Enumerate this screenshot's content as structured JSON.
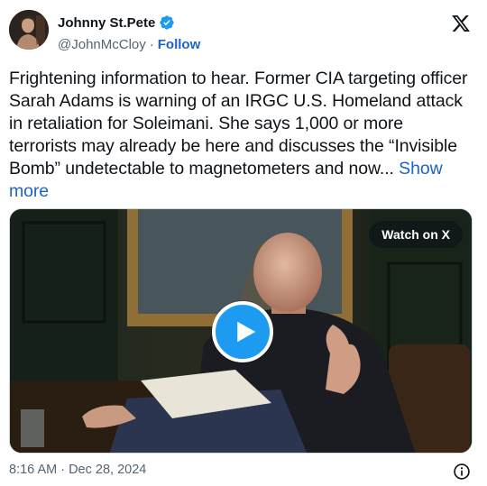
{
  "author": {
    "display_name": "Johnny St.Pete",
    "handle": "@JohnMcCloy",
    "separator": "·",
    "follow_label": "Follow",
    "verified": true,
    "verified_icon": "verified-badge-icon",
    "verified_color": "#1d9bf0"
  },
  "platform": {
    "logo_icon": "x-logo-icon"
  },
  "tweet": {
    "text": "Frightening information to hear. Former CIA targeting officer Sarah Adams is warning of an IRGC U.S. Homeland attack in retaliation for Soleimani. She says 1,000 or more terrorists may already be here and discusses the “Invisible Bomb” undetectable to magnetometers and now...",
    "show_more_label": "Show more",
    "link_color": "#1d64c4"
  },
  "media": {
    "type": "video",
    "watch_label": "Watch on X",
    "play_icon": "play-icon",
    "play_color": "#1d9bf0"
  },
  "footer": {
    "timestamp": "8:16 AM · Dec 28, 2024",
    "info_icon": "info-icon"
  }
}
